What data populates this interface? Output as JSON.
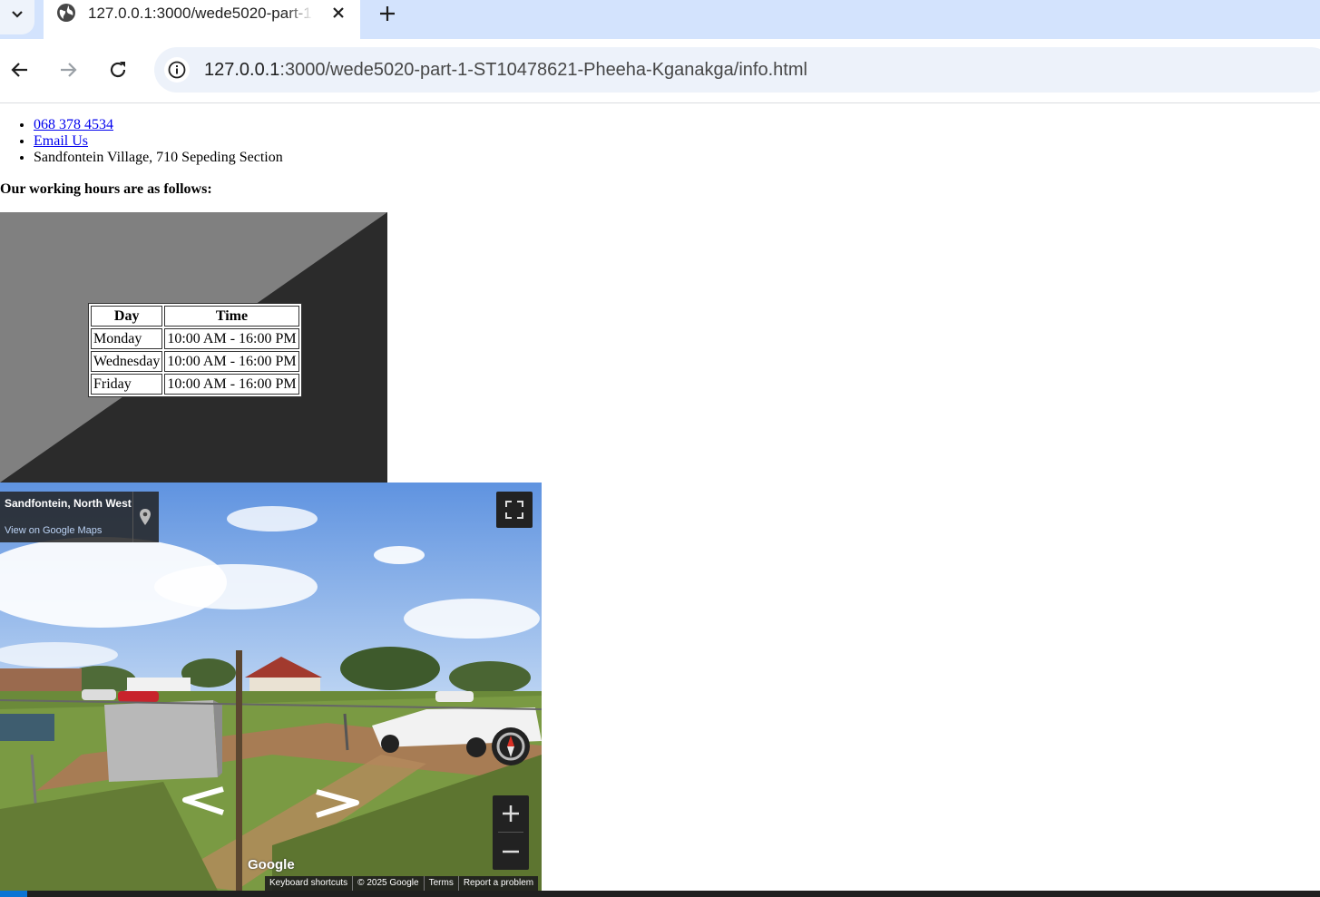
{
  "browser": {
    "tab_title": "127.0.0.1:3000/wede5020-part-1-ST10478621-Pheeha-Kganakga/info.html",
    "url_host": "127.0.0.1",
    "url_rest": ":3000/wede5020-part-1-ST10478621-Pheeha-Kganakga/info.html"
  },
  "contact": {
    "phone": "068 378 4534",
    "email_label": "Email Us",
    "address": "Sandfontein Village, 710 Sepeding Section"
  },
  "hours": {
    "heading": "Our working hours are as follows:",
    "headers": [
      "Day",
      "Time"
    ],
    "rows": [
      {
        "day": "Monday",
        "time": "10:00 AM - 16:00 PM"
      },
      {
        "day": "Wednesday",
        "time": "10:00 AM - 16:00 PM"
      },
      {
        "day": "Friday",
        "time": "10:00 AM - 16:00 PM"
      }
    ],
    "box_colors": {
      "light": "#808080",
      "dark": "#2b2b2b"
    }
  },
  "map": {
    "place_title": "Sandfontein, North West",
    "view_link": "View on Google Maps",
    "logo": "Google",
    "attributions": [
      "Keyboard shortcuts",
      "© 2025 Google",
      "Terms",
      "Report a problem"
    ],
    "icons": [
      "map-pin-icon",
      "fullscreen-icon",
      "compass-icon",
      "zoom-in-icon",
      "zoom-out-icon",
      "arrow-left-icon",
      "arrow-right-icon"
    ]
  }
}
